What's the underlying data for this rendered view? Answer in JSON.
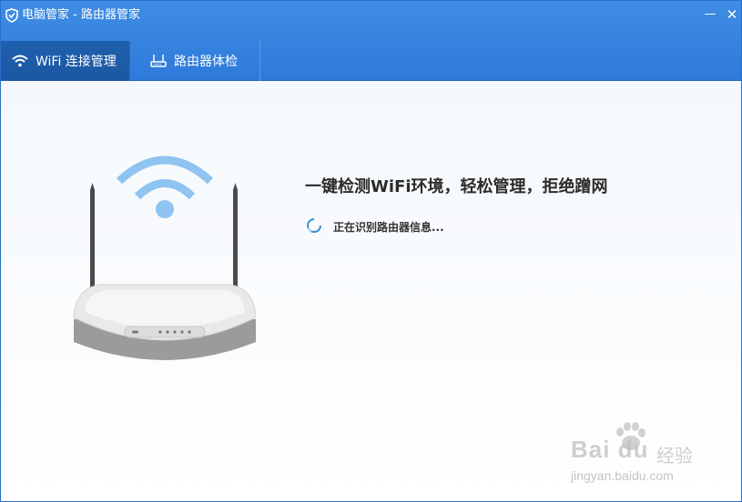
{
  "window": {
    "title": "电脑管家 - 路由器管家",
    "minimize_glyph": "—",
    "close_glyph": "✕"
  },
  "tabs": [
    {
      "label": "WiFi 连接管理",
      "icon": "wifi-icon",
      "active": true
    },
    {
      "label": "路由器体检",
      "icon": "router-icon",
      "active": false
    }
  ],
  "main": {
    "headline": "一键检测WiFi环境，轻松管理，拒绝蹭网",
    "status": "正在识别路由器信息..."
  },
  "watermark": {
    "brand": "Bai du",
    "cn": "经验",
    "url": "jingyan.baidu.com"
  },
  "colors": {
    "titlebar": "#3f8de4",
    "active_tab": "#1f5fad",
    "wifi_signal": "#8fc3f0",
    "spinner": "#3a8fd6"
  }
}
